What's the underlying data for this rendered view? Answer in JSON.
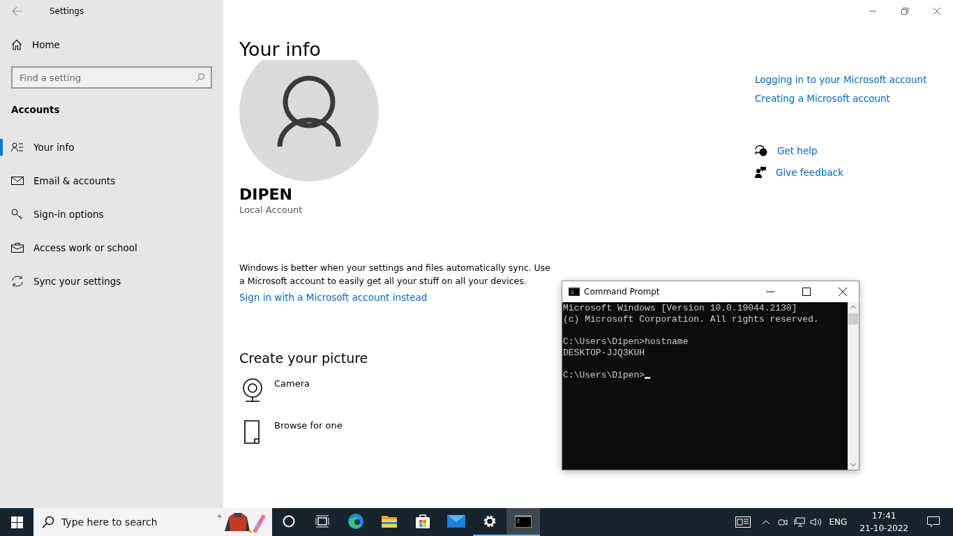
{
  "window": {
    "title": "Settings"
  },
  "sidebar": {
    "home": "Home",
    "search": {
      "placeholder": "Find a setting"
    },
    "section": "Accounts",
    "items": [
      {
        "label": "Your info",
        "kind": "person",
        "selected": true
      },
      {
        "label": "Email & accounts",
        "kind": "mail",
        "selected": false
      },
      {
        "label": "Sign-in options",
        "kind": "key",
        "selected": false
      },
      {
        "label": "Access work or school",
        "kind": "briefcase",
        "selected": false
      },
      {
        "label": "Sync your settings",
        "kind": "sync",
        "selected": false
      }
    ]
  },
  "main": {
    "title": "Your info",
    "user_name": "DIPEN",
    "account_type": "Local Account",
    "sync_text": "Windows is better when your settings and files automatically sync. Use a Microsoft account to easily get all your stuff on all your devices.",
    "sign_in_link": "Sign in with a Microsoft account instead",
    "picture_heading": "Create your picture",
    "picture_options": [
      {
        "label": "Camera",
        "kind": "camera"
      },
      {
        "label": "Browse for one",
        "kind": "file"
      }
    ]
  },
  "related": {
    "links": [
      "Logging in to your Microsoft account",
      "Creating a Microsoft account"
    ],
    "help": [
      {
        "label": "Get help",
        "kind": "help"
      },
      {
        "label": "Give feedback",
        "kind": "feedback"
      }
    ]
  },
  "console": {
    "title": "Command Prompt",
    "blocks": [
      [
        "Microsoft Windows [Version 10.0.19044.2130]",
        "(c) Microsoft Corporation. All rights reserved."
      ],
      [
        "C:\\Users\\Dipen>hostname",
        "DESKTOP-JJQ3KUH"
      ],
      [
        "C:\\Users\\Dipen>"
      ]
    ]
  },
  "taskbar": {
    "search": {
      "placeholder": "Type here to search"
    },
    "apps": [
      {
        "kind": "cortana",
        "running": false,
        "selected": false
      },
      {
        "kind": "taskview",
        "running": false,
        "selected": false
      },
      {
        "kind": "edge",
        "running": false,
        "selected": false
      },
      {
        "kind": "explorer",
        "running": false,
        "selected": false
      },
      {
        "kind": "store",
        "running": false,
        "selected": false
      },
      {
        "kind": "mail",
        "running": false,
        "selected": false
      },
      {
        "kind": "settings",
        "running": true,
        "selected": false
      },
      {
        "kind": "terminal",
        "running": true,
        "selected": true
      }
    ],
    "language": "ENG",
    "time": "17:41",
    "date": "21-10-2022"
  }
}
